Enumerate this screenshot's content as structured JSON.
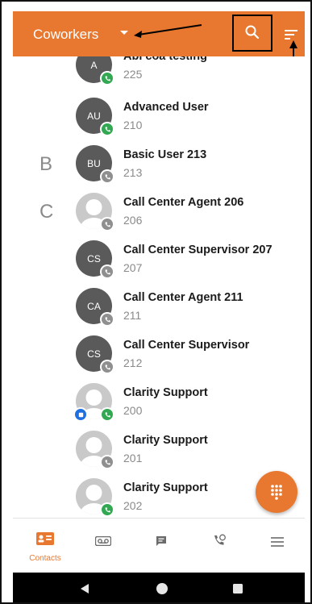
{
  "appbar": {
    "title": "Coworkers",
    "search_icon": "search-icon",
    "filter_icon": "filter-sort-icon",
    "color": "#e8782f"
  },
  "contacts": [
    {
      "initials": "A",
      "name": "Abi coa testing",
      "ext": "225",
      "status": "green",
      "photo": false,
      "letter": ""
    },
    {
      "initials": "AU",
      "name": "Advanced User",
      "ext": "210",
      "status": "green",
      "photo": false,
      "letter": ""
    },
    {
      "initials": "BU",
      "name": "Basic User 213",
      "ext": "213",
      "status": "gray",
      "photo": false,
      "letter": "B"
    },
    {
      "initials": "",
      "name": "Call Center Agent 206",
      "ext": "206",
      "status": "gray",
      "photo": true,
      "letter": "C"
    },
    {
      "initials": "CS",
      "name": "Call Center Supervisor 207",
      "ext": "207",
      "status": "gray",
      "photo": false,
      "letter": ""
    },
    {
      "initials": "CA",
      "name": "Call Center Agent 211",
      "ext": "211",
      "status": "gray",
      "photo": false,
      "letter": ""
    },
    {
      "initials": "CS",
      "name": "Call Center Supervisor",
      "ext": "212",
      "status": "gray",
      "photo": false,
      "letter": ""
    },
    {
      "initials": "",
      "name": "Clarity Support",
      "ext": "200",
      "status": "green",
      "photo": true,
      "letter": "",
      "extra_badge": "blue"
    },
    {
      "initials": "",
      "name": "Clarity Support",
      "ext": "201",
      "status": "gray",
      "photo": true,
      "letter": ""
    },
    {
      "initials": "",
      "name": "Clarity Support",
      "ext": "202",
      "status": "green",
      "photo": true,
      "letter": ""
    }
  ],
  "bottom_nav": [
    {
      "label": "Contacts",
      "icon": "contacts-icon",
      "active": true
    },
    {
      "label": "",
      "icon": "voicemail-icon",
      "active": false
    },
    {
      "label": "",
      "icon": "chat-icon",
      "active": false
    },
    {
      "label": "",
      "icon": "call-history-icon",
      "active": false
    },
    {
      "label": "",
      "icon": "menu-icon",
      "active": false
    }
  ],
  "fab": {
    "icon": "dialpad-icon"
  },
  "system_nav": [
    "back-icon",
    "home-icon",
    "recents-icon"
  ]
}
